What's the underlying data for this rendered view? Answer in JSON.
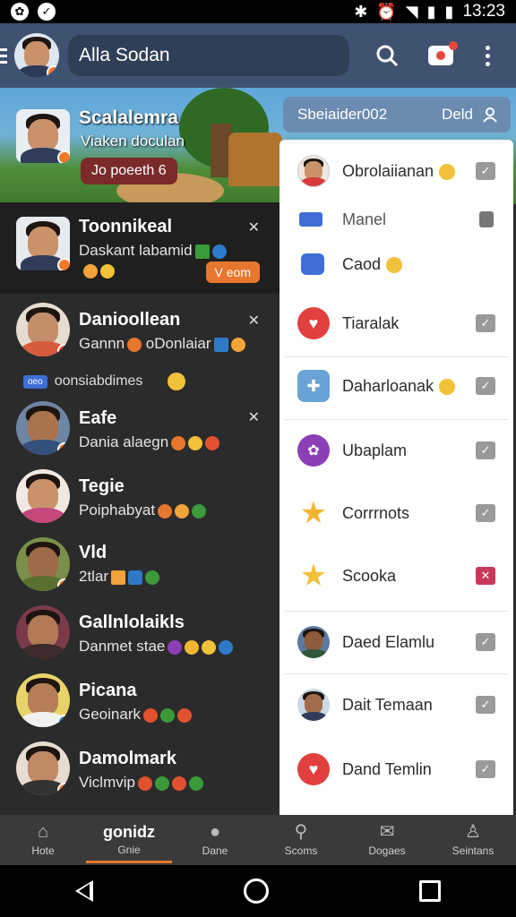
{
  "status_bar": {
    "time": "13:23"
  },
  "app_bar": {
    "search_text": "Alla Sodan"
  },
  "banner": {
    "title": "Scalalemra",
    "subtitle": "Viaken doculan",
    "pill": "Jo poeeth 6"
  },
  "right_header": {
    "label": "Sbeiaider002",
    "action": "Deld"
  },
  "chats": [
    {
      "name": "Toonnikeal",
      "message": "Daskant labamid",
      "pill": "V eom",
      "skin": "#b37a54",
      "hair": "#1a1411",
      "body": "#2f3d59",
      "badge": "#f07a2a"
    },
    {
      "name": "Danioollean",
      "message": "Gannn",
      "message2": "oDonlaiar",
      "skin": "#c48d6a",
      "hair": "#241712",
      "body": "#d65c3b",
      "badge": "#e23f3f"
    },
    {
      "name": "Eafe",
      "message": "Dania alaegn",
      "skin": "#a8734e",
      "hair": "#1b1411",
      "body": "#34507d",
      "badge": "#f07a2a"
    },
    {
      "name": "Tegie",
      "message": "Poiphabyat",
      "skin": "#c9926b",
      "hair": "#1f1410",
      "body": "#c4467a",
      "badge": null
    },
    {
      "name": "Vld",
      "message": "2tlar",
      "skin": "#9c6b47",
      "hair": "#18120f",
      "body": "#5b6f2e",
      "badge": "#f07a2a"
    },
    {
      "name": "Gallnlolaikls",
      "message": "Danmet staе",
      "skin": "#b27b55",
      "hair": "#1a1411",
      "body": "#3c2b2b",
      "badge": null
    },
    {
      "name": "Picana",
      "message": "Geoinark",
      "skin": "#b57e59",
      "hair": "#1b1411",
      "body": "#f1f1f1",
      "badge": "#2f79c9"
    },
    {
      "name": "Damolmark",
      "message": "Viclmvip",
      "skin": "#c08a66",
      "hair": "#1c1511",
      "body": "#333333",
      "badge": "#f07a2a"
    }
  ],
  "separator": {
    "tag": "oeo",
    "label": "oonsiabdimes"
  },
  "panel_rows": [
    {
      "label": "Obrolaiianan",
      "icon": "avatar",
      "icon_color": "#c9926b",
      "check": "grey"
    },
    {
      "label": "Manel",
      "icon": "tag",
      "icon_color": "#3e6ed6",
      "check": "lock"
    },
    {
      "label": "Caod",
      "icon": "chat",
      "icon_color": "#3e6ed6",
      "check": "none"
    },
    {
      "label": "Tiaralak",
      "icon": "heart",
      "icon_color": "#e23f3f",
      "check": "grey"
    },
    {
      "label": "Daharloanak",
      "icon": "puzzle",
      "icon_color": "#6aa3d8",
      "check": "grey"
    },
    {
      "label": "Ubaplam",
      "icon": "circle",
      "icon_color": "#8a3fb7",
      "check": "grey"
    },
    {
      "label": "Corrrnots",
      "icon": "star",
      "icon_color": "#f2b632",
      "check": "grey"
    },
    {
      "label": "Scooka",
      "icon": "star",
      "icon_color": "#f2c13a",
      "check": "red"
    },
    {
      "label": "Daed Elamlu",
      "icon": "avatar",
      "icon_color": "#8e5c3c",
      "check": "grey"
    },
    {
      "label": "Dait Temaan",
      "icon": "avatar",
      "icon_color": "#a16c49",
      "check": "grey"
    },
    {
      "label": "Dand Temlin",
      "icon": "heart",
      "icon_color": "#e23f3f",
      "check": "grey"
    }
  ],
  "bottom_nav": [
    {
      "label": "Hote",
      "glyph": "⌂"
    },
    {
      "label": "Gnie",
      "glyph": "gonidz"
    },
    {
      "label": "Dane",
      "glyph": "●"
    },
    {
      "label": "Scoms",
      "glyph": "⚲"
    },
    {
      "label": "Dogaes",
      "glyph": "✉"
    },
    {
      "label": "Seintans",
      "glyph": "♙"
    }
  ],
  "colors": {
    "appbar": "#3f5370",
    "accent": "#e8772e",
    "panel": "#ffffff",
    "chatlist": "#2b2b2b"
  }
}
